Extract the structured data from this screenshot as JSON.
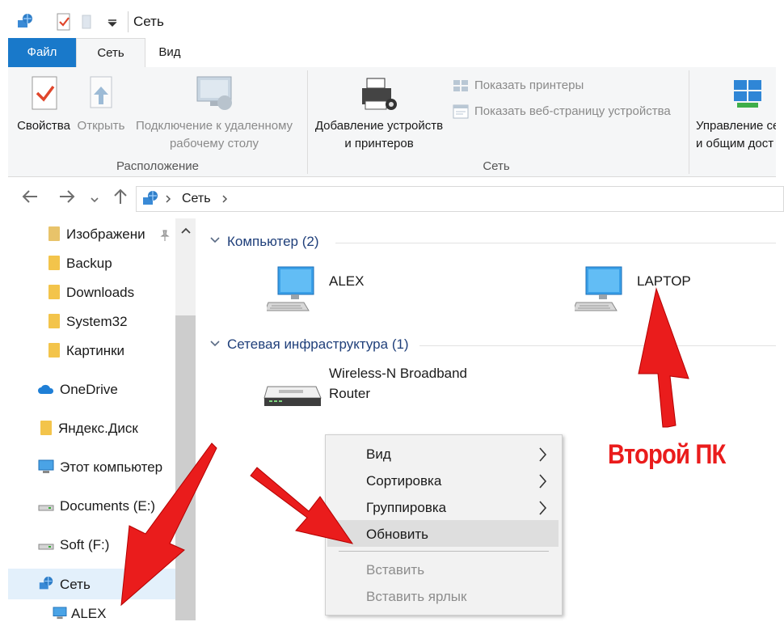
{
  "window": {
    "title": "Сеть"
  },
  "ribbon_tabs": {
    "file": "Файл",
    "network": "Сеть",
    "view": "Вид"
  },
  "ribbon": {
    "properties": "Свойства",
    "open": "Открыть",
    "remote_line1": "Подключение к удаленному",
    "remote_line2": "рабочему столу",
    "group_location": "Расположение",
    "add_devices_line1": "Добавление устройств",
    "add_devices_line2": "и принтеров",
    "show_printers": "Показать принтеры",
    "show_device_page": "Показать веб-страницу устройства",
    "group_network": "Сеть",
    "manage_line1": "Управление се",
    "manage_line2": "и общим дост"
  },
  "address_bar": {
    "path": "Сеть"
  },
  "nav_pane": {
    "items": [
      {
        "label": "Изображени",
        "pinned": true
      },
      {
        "label": "Backup"
      },
      {
        "label": "Downloads"
      },
      {
        "label": "System32"
      },
      {
        "label": "Картинки"
      },
      {
        "label": "OneDrive"
      },
      {
        "label": "Яндекс.Диск"
      },
      {
        "label": "Этот компьютер"
      },
      {
        "label": "Documents (E:)"
      },
      {
        "label": "Soft (F:)"
      },
      {
        "label": "Сеть",
        "selected": true
      },
      {
        "label": "ALEX"
      }
    ]
  },
  "content": {
    "computers_header": "Компьютер (2)",
    "computers": [
      {
        "name": "ALEX"
      },
      {
        "name": "LAPTOP"
      }
    ],
    "infra_header": "Сетевая инфраструктура (1)",
    "router_line1": "Wireless-N Broadband",
    "router_line2": "Router"
  },
  "context_menu": {
    "view": "Вид",
    "sort": "Сортировка",
    "group": "Группировка",
    "refresh": "Обновить",
    "paste": "Вставить",
    "paste_shortcut": "Вставить ярлык"
  },
  "annotation": {
    "text": "Второй ПК",
    "color": "#ea1c1c"
  },
  "colors": {
    "accent": "#1979ca",
    "section_header": "#1f3f7a",
    "selection": "#cce4f7"
  }
}
